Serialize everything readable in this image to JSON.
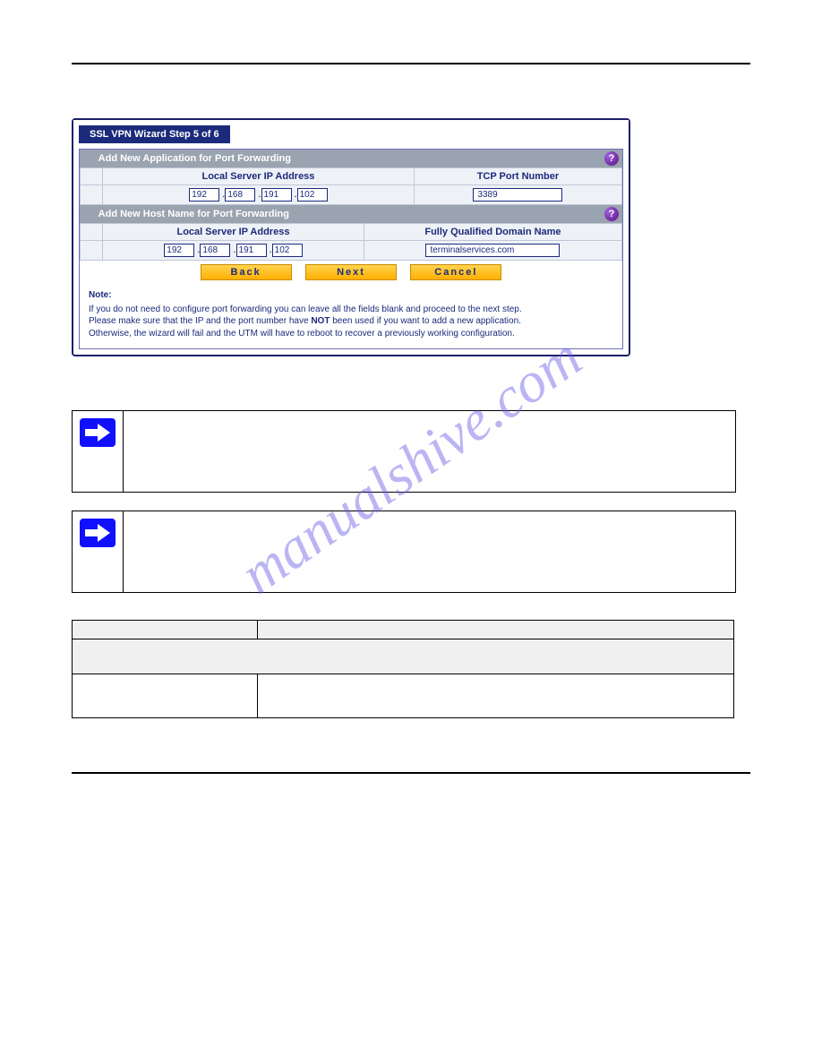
{
  "watermark": "manualshive.com",
  "screenshot": {
    "tab_title": "SSL VPN Wizard Step 5 of 6",
    "section_app": {
      "title": "Add New Application for Port Forwarding",
      "col_ip": "Local Server IP Address",
      "col_port": "TCP Port Number",
      "ip": [
        "192",
        "168",
        "191",
        "102"
      ],
      "port": "3389"
    },
    "section_host": {
      "title": "Add New Host Name for Port Forwarding",
      "col_ip": "Local Server IP Address",
      "col_fqdn": "Fully Qualified Domain Name",
      "ip": [
        "192",
        "168",
        "191",
        "102"
      ],
      "fqdn": "terminalservices.com"
    },
    "buttons": {
      "back": "Back",
      "next": "Next",
      "cancel": "Cancel"
    },
    "note": {
      "hdr": "Note:",
      "l1": "If you do not need to configure port forwarding you can leave all the fields blank and proceed to the next step.",
      "l2a": "Please make sure that the IP and the port number have ",
      "l2b": "NOT",
      "l2c": " been used if you want to add a new application.",
      "l3": "Otherwise, the wizard will fail and the UTM will have to reboot to recover a previously working configuration."
    }
  },
  "settings_table": {
    "col_setting": "",
    "col_desc": ""
  }
}
